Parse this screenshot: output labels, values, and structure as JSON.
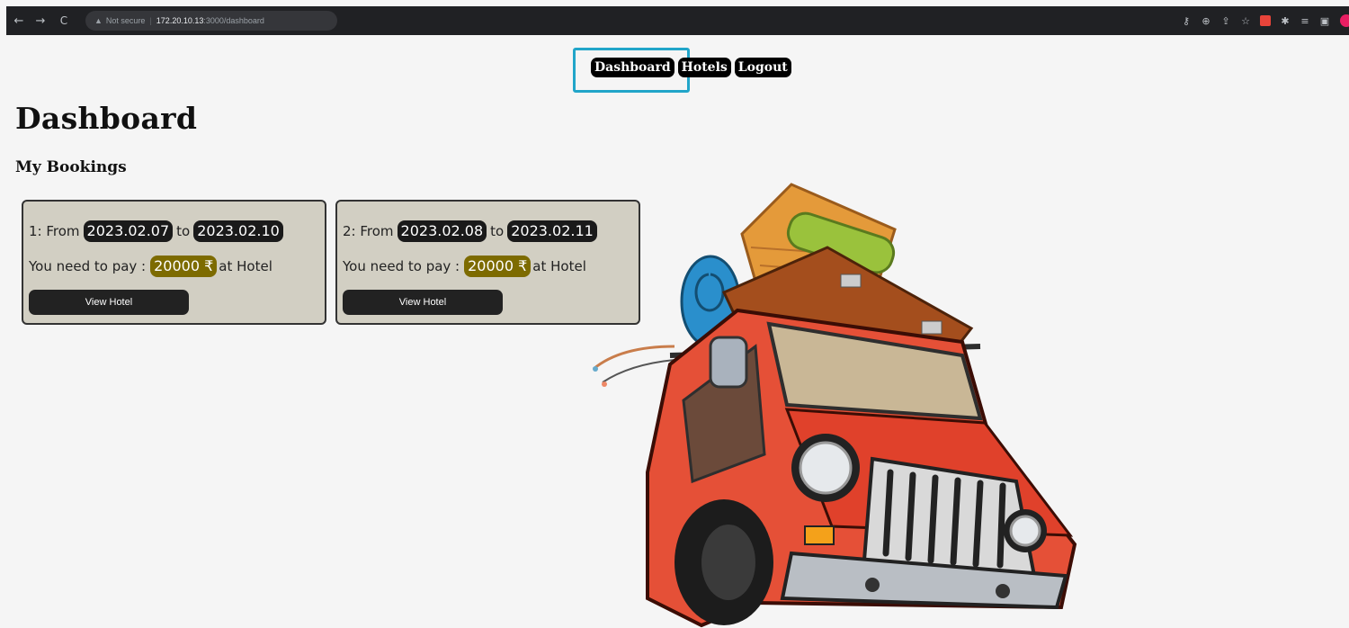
{
  "browser": {
    "security_label": "Not secure",
    "url_host": "172.20.10.13",
    "url_path": ":3000/dashboard"
  },
  "nav": {
    "items": [
      {
        "label": "Dashboard"
      },
      {
        "label": "Hotels"
      },
      {
        "label": "Logout"
      }
    ]
  },
  "page": {
    "title": "Dashboard",
    "subtitle": "My Bookings"
  },
  "bookings": [
    {
      "index": "1: From",
      "from": "2023.02.07",
      "to_label": "to",
      "to": "2023.02.10",
      "pay_label": "You need to pay :",
      "amount": "20000 ₹",
      "suffix": "at Hotel",
      "button": "View Hotel"
    },
    {
      "index": "2: From",
      "from": "2023.02.08",
      "to_label": "to",
      "to": "2023.02.11",
      "pay_label": "You need to pay :",
      "amount": "20000 ₹",
      "suffix": "at Hotel",
      "button": "View Hotel"
    }
  ],
  "colors": {
    "card_bg": "#d2cfc3",
    "price_bg": "#7d6b00",
    "highlight": "#21a5c9"
  },
  "illustration": {
    "icon": "jeep-with-luggage-illustration"
  }
}
